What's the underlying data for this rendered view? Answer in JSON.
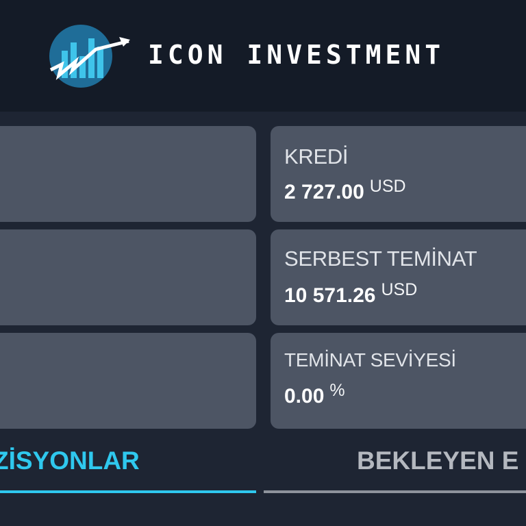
{
  "header": {
    "brand": "ICON INVESTMENT",
    "logo_icon": "rising-chart-logo-icon"
  },
  "cards": {
    "kredi": {
      "label": "KREDİ",
      "value": "2 727.00",
      "unit": "USD"
    },
    "serbest_teminat": {
      "label": "SERBEST TEMİNAT",
      "value": "10 571.26",
      "unit": "USD"
    },
    "teminat_seviyesi": {
      "label": "TEMİNAT SEVİYESİ",
      "value": "0.00",
      "unit": "%"
    }
  },
  "tabs": [
    {
      "label": "ZİSYONLAR",
      "active": true
    },
    {
      "label": "BEKLEYEN E",
      "active": false
    }
  ],
  "colors": {
    "header_bg": "#141b27",
    "page_bg": "#1e2533",
    "card_bg": "#4d5564",
    "accent": "#2fc8ee"
  }
}
